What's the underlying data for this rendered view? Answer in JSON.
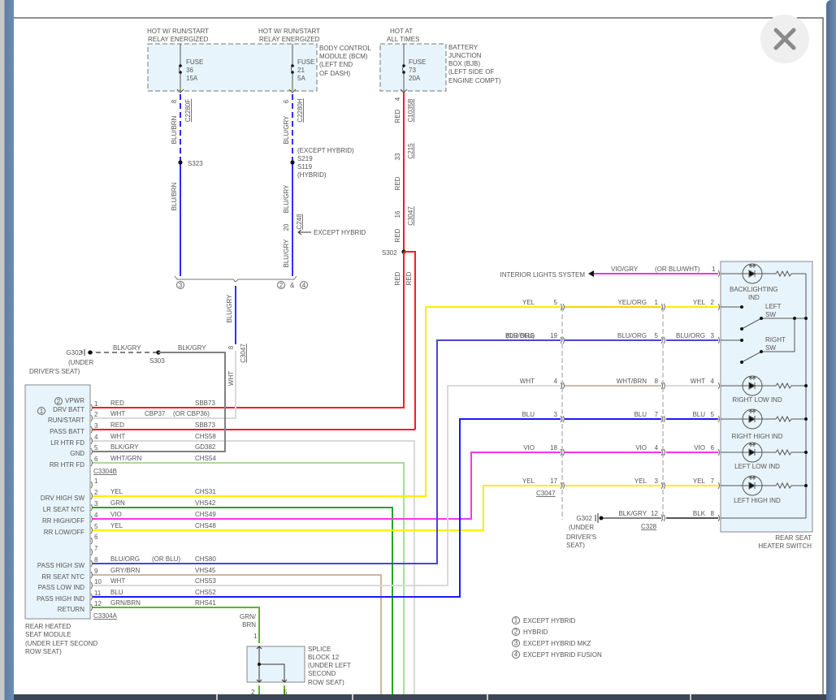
{
  "window": {
    "close_icon": "close-x-icon"
  },
  "wire_colors": {
    "RED": "#ff1a1a",
    "WHT": "#d9d9d9",
    "BLK/GRY": "#808080",
    "BLK": "#555555",
    "WHT/GRN": "#a6dc9c",
    "YEL": "#ffee00",
    "YEL/ORG": "#f7d400",
    "GRN": "#22a722",
    "VIO": "#ff33ee",
    "BLU/ORG": "#4a46d6",
    "GRY/BRN": "#c9b99b",
    "BLU": "#1a1aff",
    "GRN/BRN": "#55bb22",
    "BLU/BRN": "#2a2aff",
    "BLU/GRY": "#3030ff",
    "WHT/BRN": "#c8bca8",
    "VIO/GRY": "#e040e0"
  },
  "sources": {
    "feed_a": [
      "HOT W/ RUN/START",
      "RELAY ENERGIZED"
    ],
    "feed_b": [
      "HOT W/ RUN/START",
      "RELAY ENERGIZED"
    ],
    "feed_c": [
      "HOT AT",
      "ALL TIMES"
    ]
  },
  "bcm": {
    "label": [
      "BODY CONTROL",
      "MODULE (BCM)",
      "(LEFT END",
      "OF DASH)"
    ],
    "fuse_a": [
      "FUSE",
      "36",
      "15A"
    ],
    "fuse_b": [
      "FUSE",
      "21",
      "5A"
    ]
  },
  "bjb": {
    "label": [
      "BATTERY",
      "JUNCTION",
      "BOX (BJB)",
      "(LEFT SIDE OF",
      "ENGINE COMPT)"
    ],
    "fuse": [
      "FUSE",
      "73",
      "20A"
    ]
  },
  "feeds": {
    "a": {
      "pin": "8",
      "connector": "C2280F",
      "wire": "BLU/BRN",
      "wire2": "BLU/BRN",
      "splice": "S323"
    },
    "b": {
      "pin": "6",
      "connector": "C2280H",
      "wire": "BLU/GRY",
      "wire2": "BLU/GRY",
      "wire3": "BLU/GRY",
      "splice_notes": [
        "(EXCEPT HYBRID)",
        "S219",
        "S119",
        "(HYBRID)"
      ],
      "pin2": "20",
      "connector2": "C248",
      "note": "EXCEPT HYBRID"
    },
    "c": {
      "pin": "4",
      "connector": "C1035B",
      "wire": "RED",
      "pin2": "33",
      "connector2": "C215",
      "wire2": "RED",
      "pin3": "16",
      "connector3": "C3047",
      "wire3": "RED",
      "splice": "S302",
      "wire4": "RED",
      "wire5": "RED"
    },
    "merge": {
      "left_note": "3",
      "right_note_a": "2",
      "amp": "&",
      "right_note_b": "4",
      "wire": "BLU/GRY",
      "pin": "8",
      "connector": "C3047",
      "wire2": "WHT"
    }
  },
  "ground_top": {
    "name": "G302",
    "location": [
      "(UNDER",
      "DRIVER'S SEAT)"
    ],
    "wire": "BLK/GRY",
    "wire2": "BLK/GRY",
    "splice": "S303"
  },
  "module": {
    "name_lines": [
      "REAR HEATED",
      "SEAT MODULE",
      "(UNDER LEFT SECOND",
      "ROW SEAT)"
    ],
    "note_1": "1",
    "note_2": "2",
    "connector_b": "C3304B",
    "connector_a": "C3304A",
    "rows_b": [
      {
        "pin": "1",
        "wire": "RED",
        "circuit": "SBB73",
        "function": "DRV BATT",
        "alt_function": "VPWR"
      },
      {
        "pin": "2",
        "wire": "WHT",
        "circuit": "CBP37",
        "circuit_alt": "(OR CBP36)",
        "function": "RUN/START"
      },
      {
        "pin": "3",
        "wire": "RED",
        "circuit": "SBB73",
        "function": "PASS BATT"
      },
      {
        "pin": "4",
        "wire": "WHT",
        "circuit": "CHS58",
        "function": "LR HTR FD"
      },
      {
        "pin": "5",
        "wire": "BLK/GRY",
        "circuit": "GD382",
        "function": "GND"
      },
      {
        "pin": "6",
        "wire": "WHT/GRN",
        "circuit": "CHS54",
        "function": "RR HTR FD"
      }
    ],
    "rows_a": [
      {
        "pin": "1"
      },
      {
        "pin": "2",
        "wire": "YEL",
        "circuit": "CHS31",
        "function": "DRV HIGH SW"
      },
      {
        "pin": "3",
        "wire": "GRN",
        "circuit": "VHS42",
        "function": "LR SEAT NTC"
      },
      {
        "pin": "4",
        "wire": "VIO",
        "circuit": "CHS49",
        "function": "RR HIGH/OFF"
      },
      {
        "pin": "5",
        "wire": "YEL",
        "circuit": "CHS48",
        "function": "RR LOW/OFF"
      },
      {
        "pin": "6"
      },
      {
        "pin": "7"
      },
      {
        "pin": "8",
        "wire": "BLU/ORG",
        "wire_alt": "(OR BLU)",
        "circuit": "CHS80",
        "function": "PASS HIGH SW"
      },
      {
        "pin": "9",
        "wire": "GRY/BRN",
        "circuit": "VHS45",
        "function": "RR SEAT NTC"
      },
      {
        "pin": "10",
        "wire": "WHT",
        "circuit": "CHS53",
        "function": "PASS LOW IND"
      },
      {
        "pin": "11",
        "wire": "BLU",
        "circuit": "CHS52",
        "function": "PASS HIGH IND"
      },
      {
        "pin": "12",
        "wire": "GRN/BRN",
        "circuit": "RHS41",
        "function": "RETURN"
      }
    ]
  },
  "splice_block": {
    "label": [
      "SPLICE",
      "BLOCK 12",
      "(UNDER LEFT",
      "SECOND",
      "ROW SEAT)"
    ],
    "wire": [
      "GRN/",
      "BRN"
    ],
    "pin_in": "1",
    "pin_out_a": "2",
    "pin_out_b": "5"
  },
  "switch_side": {
    "connector_left": "C3047",
    "connector_mid": "C328",
    "interior_lights": "INTERIOR LIGHTS SYSTEM",
    "ground": {
      "name": "G302",
      "location": [
        "(UNDER",
        "DRIVER'S",
        "SEAT)"
      ]
    },
    "rows": [
      {
        "left": {
          "wire": "VIO/GRY",
          "alt": "(OR BLU/WHT)"
        },
        "right": {
          "pin": "1"
        }
      },
      {
        "left": {
          "wire": "YEL",
          "pin": "5"
        },
        "mid": {
          "wire": "YEL/ORG",
          "pin": "1"
        },
        "right": {
          "wire": "YEL",
          "pin": "2"
        }
      },
      {
        "left": {
          "wire": "BLU/ORG",
          "alt": "(OR BLU)",
          "pin": "19"
        },
        "mid": {
          "wire": "BLU/ORG",
          "pin": "5"
        },
        "right": {
          "wire": "BLU/ORG",
          "pin": "3"
        }
      },
      {
        "left": {
          "wire": "WHT",
          "pin": "4"
        },
        "mid": {
          "wire": "WHT/BRN",
          "pin": "8"
        },
        "right": {
          "wire": "WHT",
          "pin": "4"
        }
      },
      {
        "left": {
          "wire": "BLU",
          "pin": "3"
        },
        "mid": {
          "wire": "BLU",
          "pin": "7"
        },
        "right": {
          "wire": "BLU",
          "pin": "5"
        }
      },
      {
        "left": {
          "wire": "VIO",
          "pin": "18"
        },
        "mid": {
          "wire": "VIO",
          "pin": "4"
        },
        "right": {
          "wire": "VIO",
          "pin": "6"
        }
      },
      {
        "left": {
          "wire": "YEL",
          "pin": "17"
        },
        "mid": {
          "wire": "YEL",
          "pin": "3"
        },
        "right": {
          "wire": "YEL",
          "pin": "7"
        }
      },
      {
        "mid": {
          "wire": "BLK/GRY",
          "pin": "12"
        },
        "right": {
          "wire": "BLK",
          "pin": "8"
        }
      }
    ]
  },
  "switch": {
    "name_lines": [
      "REAR SEAT",
      "HEATER SWITCH"
    ],
    "backlighting": [
      "BACKLIGHTING",
      "IND"
    ],
    "left_sw": [
      "LEFT",
      "SW"
    ],
    "right_sw": [
      "RIGHT",
      "SW"
    ],
    "indicators": [
      "RIGHT LOW IND",
      "RIGHT HIGH IND",
      "LEFT LOW IND",
      "LEFT HIGH IND"
    ]
  },
  "legend": [
    {
      "num": "1",
      "text": "EXCEPT HYBRID"
    },
    {
      "num": "2",
      "text": "HYBRID"
    },
    {
      "num": "3",
      "text": "EXCEPT HYBRID MKZ"
    },
    {
      "num": "4",
      "text": "EXCEPT HYBRID FUSION"
    }
  ]
}
